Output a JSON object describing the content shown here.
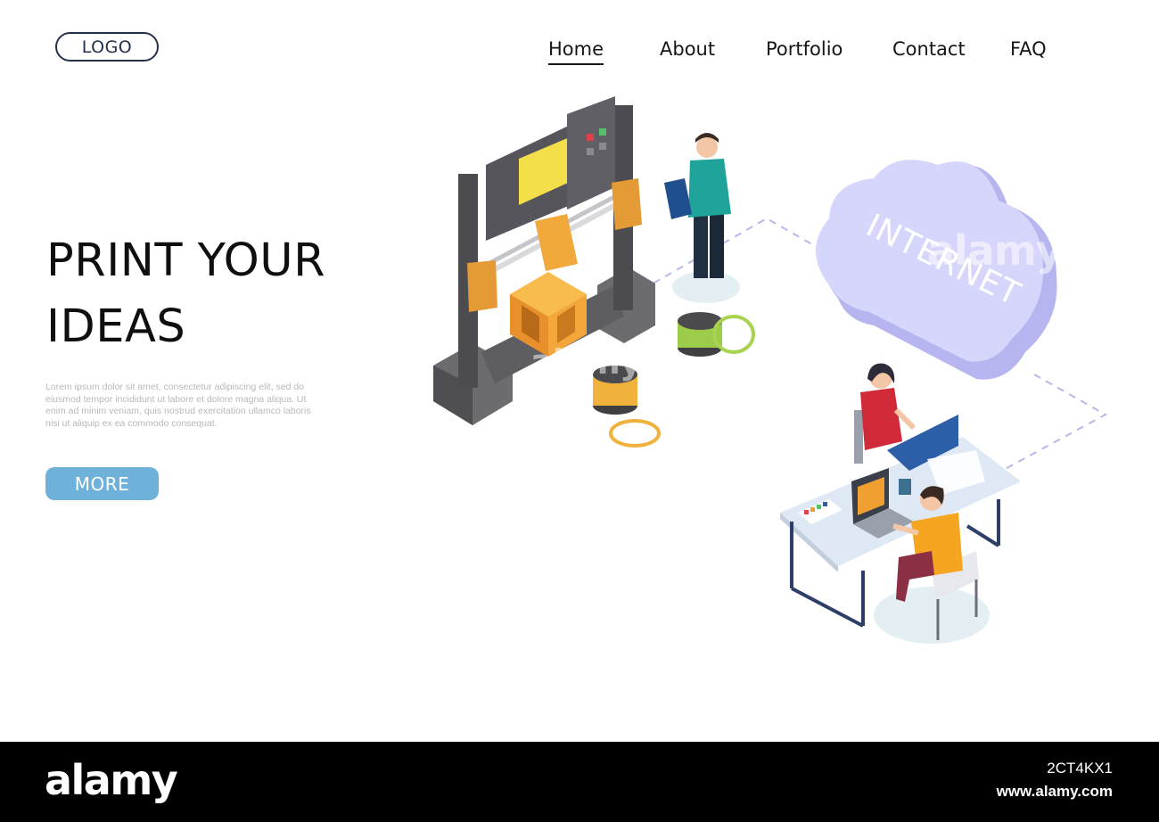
{
  "header": {
    "logo": "LOGO",
    "nav": [
      {
        "label": "Home",
        "active": true
      },
      {
        "label": "About",
        "active": false
      },
      {
        "label": "Portfolio",
        "active": false
      },
      {
        "label": "Contact",
        "active": false
      },
      {
        "label": "FAQ",
        "active": false
      }
    ]
  },
  "hero": {
    "title_line1": "PRINT YOUR",
    "title_line2": "IDEAS",
    "body": "Lorem ipsum dolor sit amet, consectetur adipiscing elit, sed do eiusmod tempor incididunt ut labore et dolore magna aliqua. Ut enim ad minim veniam, quis nostrud exercitation ullamco laboris nisi ut aliquip ex ea commodo consequat.",
    "button_label": "MORE"
  },
  "illustration": {
    "cloud_label": "INTERNET"
  },
  "watermark": {
    "brand": "alamy",
    "image_id": "2CT4KX1",
    "url": "www.alamy.com"
  },
  "colors": {
    "accent": "#6fb2d9",
    "logo_border": "#23324a",
    "cloud": "#c9c8f4",
    "printer_body": "#5a5a5f",
    "printed_object": "#f0a030"
  }
}
